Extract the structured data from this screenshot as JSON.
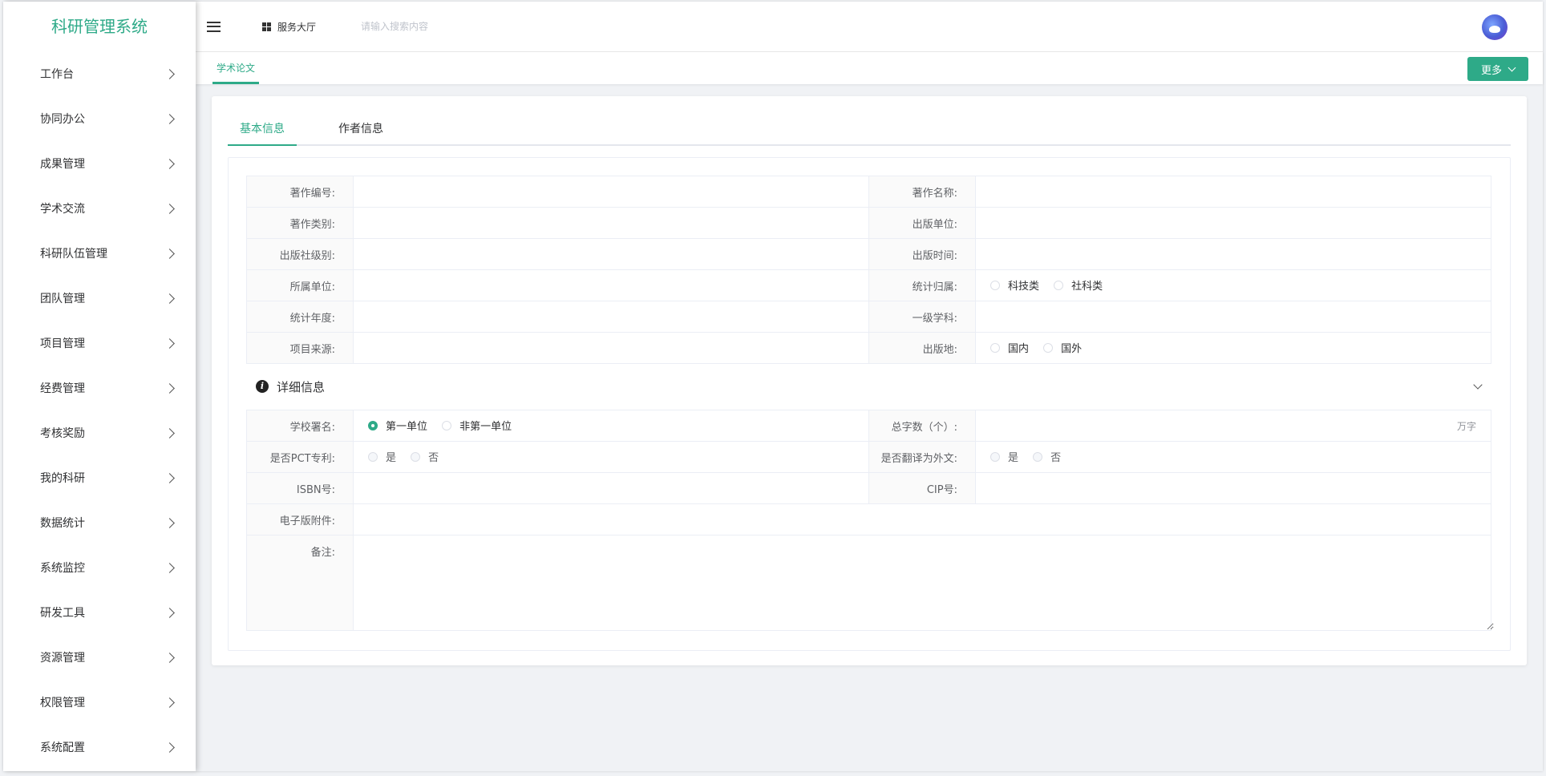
{
  "app": {
    "title": "科研管理系统"
  },
  "sidebar": {
    "items": [
      {
        "label": "工作台"
      },
      {
        "label": "协同办公"
      },
      {
        "label": "成果管理"
      },
      {
        "label": "学术交流"
      },
      {
        "label": "科研队伍管理"
      },
      {
        "label": "团队管理"
      },
      {
        "label": "项目管理"
      },
      {
        "label": "经费管理"
      },
      {
        "label": "考核奖励"
      },
      {
        "label": "我的科研"
      },
      {
        "label": "数据统计"
      },
      {
        "label": "系统监控"
      },
      {
        "label": "研发工具"
      },
      {
        "label": "资源管理"
      },
      {
        "label": "权限管理"
      },
      {
        "label": "系统配置"
      }
    ]
  },
  "header": {
    "service_hall": "服务大厅",
    "search_placeholder": "请输入搜索内容"
  },
  "tags": {
    "active": "学术论文",
    "more": "更多"
  },
  "tabs": {
    "basic": "基本信息",
    "author": "作者信息"
  },
  "basic_form": {
    "book_no": "著作编号:",
    "book_name": "著作名称:",
    "book_type": "著作类别:",
    "publisher": "出版单位:",
    "publisher_level": "出版社级别:",
    "publish_time": "出版时间:",
    "affiliation": "所属单位:",
    "stat_category": "统计归属:",
    "stat_options": [
      "科技类",
      "社科类"
    ],
    "stat_year": "统计年度:",
    "primary_subject": "一级学科:",
    "project_source": "项目来源:",
    "publish_place": "出版地:",
    "place_options": [
      "国内",
      "国外"
    ]
  },
  "detail": {
    "title": "详细信息",
    "school_sign": "学校署名:",
    "school_options": [
      "第一单位",
      "非第一单位"
    ],
    "word_count": "总字数（个）:",
    "word_unit": "万字",
    "pct": "是否PCT专利:",
    "yes": "是",
    "no": "否",
    "translated": "是否翻译为外文:",
    "isbn": "ISBN号:",
    "cip": "CIP号:",
    "attachment": "电子版附件:",
    "remarks": "备注:"
  }
}
